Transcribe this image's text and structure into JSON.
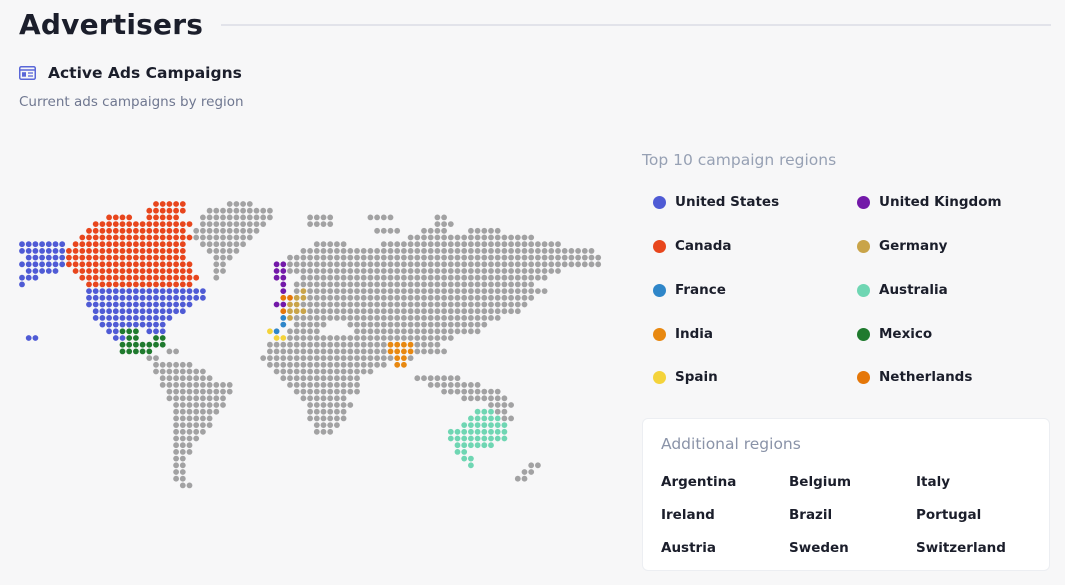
{
  "header": {
    "title": "Advertisers"
  },
  "section": {
    "icon": "layout-panel-icon",
    "title": "Active Ads Campaigns",
    "subtitle": "Current ads campaigns by region"
  },
  "colors": {
    "land": "#a2a2a3",
    "united_states": "#4f5bd5",
    "canada": "#e8461d",
    "france": "#2f86c9",
    "india": "#e88810",
    "spain": "#f4d33b",
    "united_kingdom": "#7319a9",
    "germany": "#c9a449",
    "australia": "#6fd6b3",
    "mexico": "#1f7a2e",
    "netherlands": "#e57709"
  },
  "legend": {
    "heading": "Top 10 campaign regions",
    "items": [
      {
        "label": "United States",
        "color": "#4f5bd5"
      },
      {
        "label": "Canada",
        "color": "#e8461d"
      },
      {
        "label": "France",
        "color": "#2f86c9"
      },
      {
        "label": "India",
        "color": "#e88810"
      },
      {
        "label": "Spain",
        "color": "#f4d33b"
      },
      {
        "label": "United Kingdom",
        "color": "#7319a9"
      },
      {
        "label": "Germany",
        "color": "#c9a449"
      },
      {
        "label": "Australia",
        "color": "#6fd6b3"
      },
      {
        "label": "Mexico",
        "color": "#1f7a2e"
      },
      {
        "label": "Netherlands",
        "color": "#e57709"
      }
    ]
  },
  "additional": {
    "heading": "Additional regions",
    "items": [
      "Argentina",
      "Belgium",
      "Italy",
      "Ireland",
      "Brazil",
      "Portugal",
      "Austria",
      "Sweden",
      "Switzerland"
    ]
  }
}
